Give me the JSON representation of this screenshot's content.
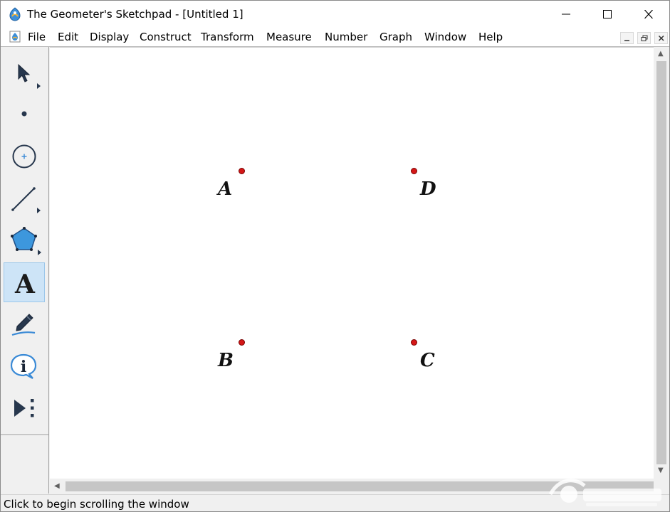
{
  "app": {
    "title": "The Geometer's Sketchpad - [Untitled 1]",
    "icon": "sketchpad-app-icon"
  },
  "menu": {
    "items": [
      {
        "label": "File"
      },
      {
        "label": "Edit"
      },
      {
        "label": "Display"
      },
      {
        "label": "Construct"
      },
      {
        "label": "Transform"
      },
      {
        "label": "Measure"
      },
      {
        "label": "Number"
      },
      {
        "label": "Graph"
      },
      {
        "label": "Window"
      },
      {
        "label": "Help"
      }
    ]
  },
  "toolbox": {
    "tools": [
      {
        "name": "arrow-tool",
        "icon": "cursor-arrow-icon"
      },
      {
        "name": "point-tool",
        "icon": "point-icon"
      },
      {
        "name": "compass-tool",
        "icon": "circle-icon"
      },
      {
        "name": "straightedge-tool",
        "icon": "line-segment-icon"
      },
      {
        "name": "polygon-tool",
        "icon": "pentagon-icon"
      },
      {
        "name": "text-tool",
        "icon": "letter-a-icon",
        "glyph": "A",
        "selected": true
      },
      {
        "name": "marker-tool",
        "icon": "marker-pen-icon"
      },
      {
        "name": "information-tool",
        "icon": "info-icon",
        "glyph": "i"
      },
      {
        "name": "custom-tool",
        "icon": "play-custom-tools-icon"
      }
    ]
  },
  "sketch": {
    "points": [
      {
        "label": "A"
      },
      {
        "label": "D"
      },
      {
        "label": "B"
      },
      {
        "label": "C"
      }
    ],
    "point_color": "#d41717"
  },
  "status": {
    "text": "Click to begin scrolling the window"
  },
  "colors": {
    "selected_tool_bg": "#cde4f7",
    "pentagon_fill": "#3d97dd"
  }
}
